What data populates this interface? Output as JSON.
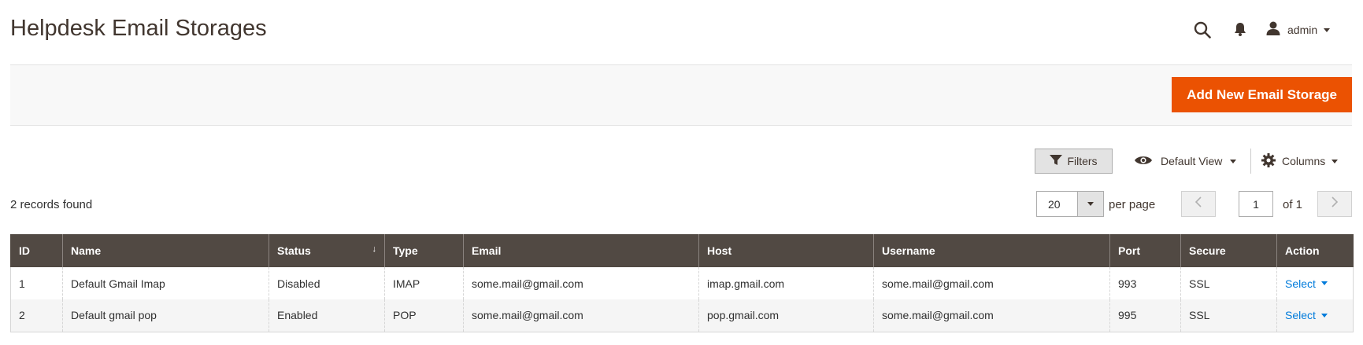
{
  "header": {
    "title": "Helpdesk Email Storages",
    "user_label": "admin",
    "icons": [
      "search-icon",
      "bell-icon",
      "user-icon"
    ]
  },
  "page_actions": {
    "add_button_label": "Add New Email Storage"
  },
  "grid_controls": {
    "filters_label": "Filters",
    "view_label": "Default View",
    "columns_label": "Columns"
  },
  "pager": {
    "records_found": "2 records found",
    "per_page_value": "20",
    "per_page_label": "per page",
    "current_page": "1",
    "of_label": "of 1"
  },
  "table": {
    "columns": [
      "ID",
      "Name",
      "Status",
      "Type",
      "Email",
      "Host",
      "Username",
      "Port",
      "Secure",
      "Action"
    ],
    "sorted_column": "Status",
    "sort_indicator": "↓",
    "rows": [
      {
        "id": "1",
        "name": "Default Gmail Imap",
        "status": "Disabled",
        "type": "IMAP",
        "email": "some.mail@gmail.com",
        "host": "imap.gmail.com",
        "username": "some.mail@gmail.com",
        "port": "993",
        "secure": "SSL",
        "action": "Select"
      },
      {
        "id": "2",
        "name": "Default gmail pop",
        "status": "Enabled",
        "type": "POP",
        "email": "some.mail@gmail.com",
        "host": "pop.gmail.com",
        "username": "some.mail@gmail.com",
        "port": "995",
        "secure": "SSL",
        "action": "Select"
      }
    ]
  },
  "colors": {
    "primary_button": "#eb5202",
    "table_header": "#514943",
    "link": "#007bdb"
  }
}
